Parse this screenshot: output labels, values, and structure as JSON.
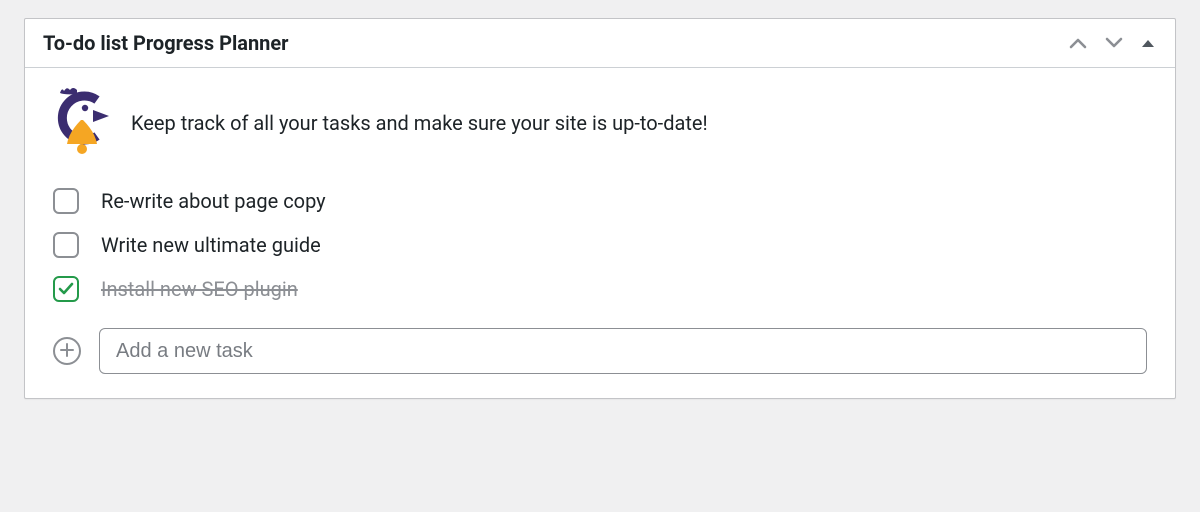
{
  "widget": {
    "title": "To-do list Progress Planner",
    "intro_text": "Keep track of all your tasks and make sure your site is up-to-date!"
  },
  "tasks": {
    "items": {
      "0": {
        "label": "Re-write about page copy",
        "checked": false
      },
      "1": {
        "label": "Write new ultimate guide",
        "checked": false
      },
      "2": {
        "label": "Install new SEO plugin",
        "checked": true
      }
    }
  },
  "add_task": {
    "placeholder": "Add a new task"
  }
}
